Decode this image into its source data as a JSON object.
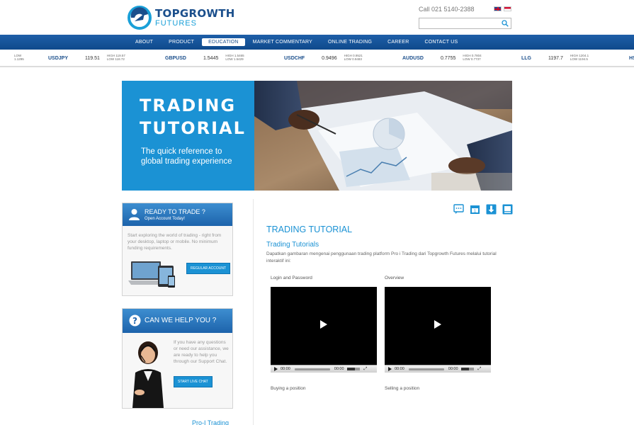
{
  "header": {
    "brand_name": "TOPGROWTH",
    "brand_sub": "FUTURES",
    "call": "Call 021 5140-2388",
    "search_placeholder": ""
  },
  "nav": {
    "items": [
      {
        "label": "ABOUT"
      },
      {
        "label": "PRODUCT"
      },
      {
        "label": "EDUCATION"
      },
      {
        "label": "MARKET COMMENTARY"
      },
      {
        "label": "ONLINE TRADING"
      },
      {
        "label": "CAREER"
      },
      {
        "label": "CONTACT US"
      }
    ],
    "active": "EDUCATION"
  },
  "ticker": [
    {
      "symbol": "",
      "price": "",
      "high": "LOW",
      "low": "1.1295"
    },
    {
      "symbol": "USDJPY",
      "price": "119.51",
      "high": "HIGH 119.57",
      "low": "LOW 118.72"
    },
    {
      "symbol": "GBPUSD",
      "price": "1.5445",
      "high": "HIGH 1.5465",
      "low": "LOW 1.5429"
    },
    {
      "symbol": "USDCHF",
      "price": "0.9496",
      "high": "HIGH 0.9521",
      "low": "LOW 0.9483"
    },
    {
      "symbol": "AUDUSD",
      "price": "0.7755",
      "high": "HIGH 0.7804",
      "low": "LOW 0.7737"
    },
    {
      "symbol": "LLG",
      "price": "1197.7",
      "high": "HIGH 1204.1",
      "low": "LOW 1194.5"
    },
    {
      "symbol": "HS",
      "price": "",
      "high": "",
      "low": ""
    }
  ],
  "hero": {
    "title_line1": "TRADING",
    "title_line2": "TUTORIAL",
    "subtitle_line1": "The quick reference to",
    "subtitle_line2": "global trading experience"
  },
  "sidebar": {
    "card1": {
      "title": "READY TO TRADE ?",
      "subtitle": "Open Account Today!",
      "text": "Start exploring the world of trading - right from your desktop, laptop or mobile. No minimum funding requirements.",
      "button": "REGULAR ACCOUNT"
    },
    "card2": {
      "title": "CAN WE HELP YOU ?",
      "text": "If you have any questions or need our assistance, we are ready to help you through our Support Chat.",
      "button": "START LIVE CHAT"
    },
    "card3_title": "Pro-I Trading"
  },
  "main": {
    "title": "TRADING TUTORIAL",
    "subtitle": "Trading Tutorials",
    "description": "Dapatkan gambaran mengenai penggunaan trading platform Pro i Trading dari Topgrowth Futures melalui tutorial interaktif ini:",
    "videos": [
      {
        "label": "Login and Password",
        "time_current": "00:00",
        "time_total": "00:00"
      },
      {
        "label": "Overview",
        "time_current": "00:00",
        "time_total": "00:00"
      }
    ],
    "more_labels": [
      "Buying a position",
      "Selling a position"
    ]
  },
  "colors": {
    "brand_blue": "#1b4f8c",
    "accent": "#1b92d4",
    "nav": "#1e5fa8"
  }
}
